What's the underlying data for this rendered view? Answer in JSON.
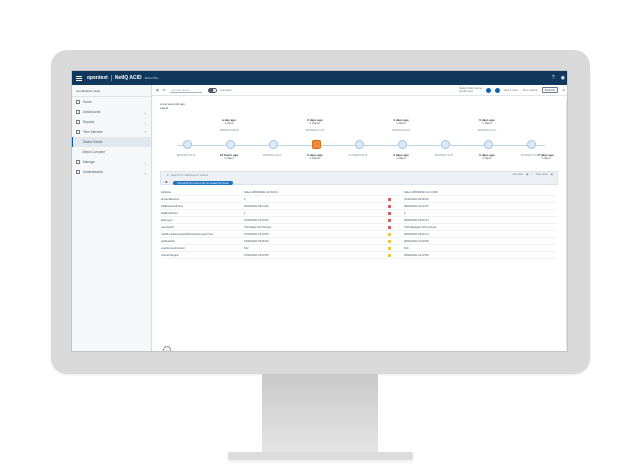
{
  "header": {
    "brand": "opentext",
    "product": "NetIQ ACID",
    "version": "v8.9.2 Pre",
    "icons": [
      "help-icon",
      "user-icon"
    ]
  },
  "sidebar": {
    "header": "omnidashcm.local",
    "items": [
      {
        "label": "Home"
      },
      {
        "label": "Dashboards"
      },
      {
        "label": "Reports"
      },
      {
        "label": "Time Machine"
      },
      {
        "label": "Status Viewer",
        "active": true
      },
      {
        "label": "Object Compare"
      },
      {
        "label": "Manage"
      },
      {
        "label": "Administration"
      }
    ]
  },
  "toolbar": {
    "search_placeholder": "Search object",
    "toggle_label": "Compare",
    "status_top": "Select field name",
    "status_value": "jsmith.test",
    "last_hour": "last 1 hour",
    "timeframe": "Time stamp",
    "button": "Refresh"
  },
  "timeline": {
    "title": "a few seconds ago",
    "subtitle": "Latest",
    "top_events": [
      {
        "label": "a day ago",
        "sub": "1 event"
      },
      {
        "label": "2 days ago",
        "sub": "2 objects"
      },
      {
        "label": "4 days ago",
        "sub": "1 object"
      },
      {
        "label": "6 days ago",
        "sub": "1 object"
      }
    ],
    "bottom_events": [
      {
        "label": "13 hours ago",
        "sub": "1 object"
      },
      {
        "label": "2 days ago",
        "sub": "2 objects"
      },
      {
        "label": "3 days ago",
        "sub": "1 object"
      },
      {
        "label": "5 days ago",
        "sub": "1 object"
      },
      {
        "label": "7 days ago",
        "sub": "1 object"
      }
    ],
    "stamps_top": [
      "28/03/2024 09:49",
      "28/03/2024 11:12",
      "27/03/2024 09:01",
      "26/03/2024 12:17",
      "24/03/2024 10:08"
    ],
    "stamps_bottom": [
      "28/03/2024 16:40",
      "28/03/2024 12:13",
      "27/03/2024 09:12",
      "25/03/2024 15:37",
      "23/03/2024 11:05"
    ]
  },
  "compare": {
    "search_placeholder": "Search for attributes or values",
    "pill": "CN=jsmith,OU=Users,DC=omnidash,DC=local",
    "right_labels": [
      "Old value",
      "New value"
    ]
  },
  "table": {
    "rows": [
      [
        "Attribute",
        "Value (28/03/2024 11:09:31)",
        "",
        "Value (28/03/2024 11:12:08)"
      ],
      [
        "accountExpires",
        "0",
        "red",
        "31/12/2024 00:00:00"
      ],
      [
        "badPasswordTime",
        "26/03/2024 08:14:22",
        "red",
        "28/03/2024 11:10:45"
      ],
      [
        "badPwdCount",
        "1",
        "red",
        "2"
      ],
      [
        "lastLogon",
        "27/03/2024 16:22:05",
        "red",
        "28/03/2024 09:02:14"
      ],
      [
        "memberOf",
        "CN=Sales,OU=Groups",
        "red",
        "CN=Managers,OU=Groups"
      ],
      [
        "msDS-LastSuccessfulInteractiveLogonTime",
        "27/03/2024 16:22:05",
        "yellow",
        "28/03/2024 09:02:14"
      ],
      [
        "pwdLastSet",
        "15/02/2024 09:00:00",
        "yellow",
        "28/03/2024 11:09:58"
      ],
      [
        "userAccountControl",
        "512",
        "yellow",
        "514"
      ],
      [
        "whenChanged",
        "27/03/2024 16:22:05",
        "yellow",
        "28/03/2024 11:12:08"
      ]
    ],
    "colors": {
      "red": "#d85b5b",
      "yellow": "#f0c340"
    }
  },
  "colors": {
    "header": "#10385c",
    "accent": "#0b5cab",
    "active_node": "#f28c38"
  }
}
